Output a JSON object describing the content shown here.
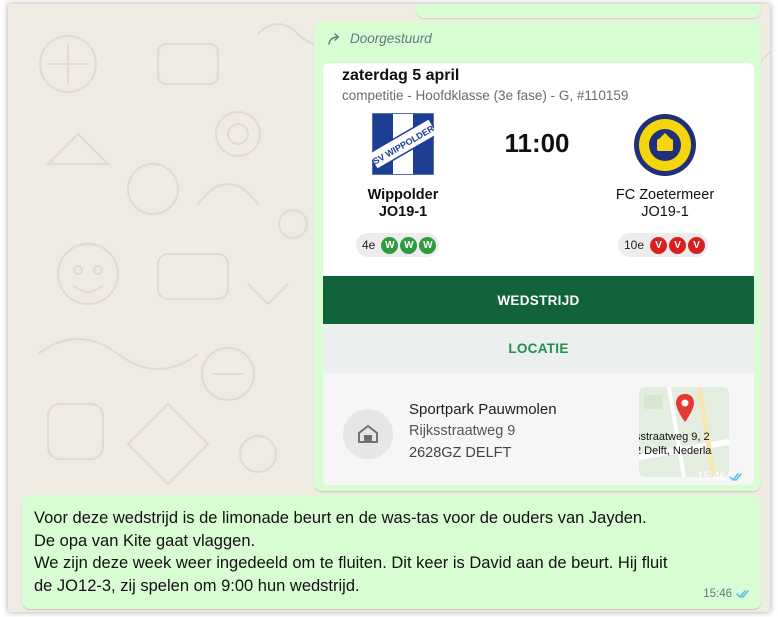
{
  "forwarded_label": "Doorgestuurd",
  "match": {
    "date": "zaterdag 5 april",
    "competition": "competitie - Hoofdklasse (3e fase) - G, #110159",
    "time": "11:00",
    "home": {
      "name_line1": "Wippolder",
      "name_line2": "JO19-1",
      "rank": "4e",
      "form": [
        "W",
        "W",
        "W"
      ],
      "logo_text": "SV WIPPOLDER"
    },
    "away": {
      "name_line1": "FC Zoetermeer",
      "name_line2": "JO19-1",
      "rank": "10e",
      "form": [
        "V",
        "V",
        "V"
      ]
    }
  },
  "tabs": {
    "match": "WEDSTRIJD",
    "location": "LOCATIE"
  },
  "venue": {
    "name": "Sportpark Pauwmolen",
    "street": "Rijksstraatweg 9",
    "zip_city": "2628GZ DELFT",
    "map_line1": "sstraatweg 9, 2",
    "map_line2": "2 Delft, Nederla"
  },
  "message1_time": "15:46",
  "message2": {
    "lines": [
      "Voor deze wedstrijd is de limonade beurt en de was-tas voor de ouders van Jayden.",
      "De opa van Kite gaat vlaggen.",
      "We zijn deze week weer ingedeeld om te fluiten. Dit keer is David aan de beurt. Hij fluit",
      "de JO12-3, zij spelen om 9:00 hun wedstrijd."
    ],
    "time": "15:46"
  },
  "colors": {
    "bubble": "#d9fdd3",
    "wallpaper": "#efeae2",
    "win": "#2e9b3e",
    "loss": "#d62121",
    "match_tab": "#11633a",
    "location_text": "#1f8f50",
    "read_ticks": "#53bdeb"
  },
  "icons": [
    "forward-icon",
    "club-crest",
    "home-icon",
    "map-pin-icon",
    "double-check-icon"
  ]
}
